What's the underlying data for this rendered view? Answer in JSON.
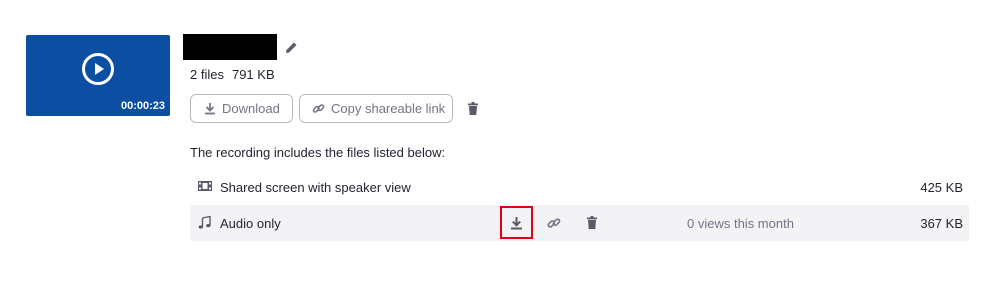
{
  "recording": {
    "duration": "00:00:23",
    "file_count": "2 files",
    "total_size": "791 KB"
  },
  "actions": {
    "download_label": "Download",
    "copy_link_label": "Copy shareable link"
  },
  "files_heading": "The recording includes the files listed below:",
  "files": [
    {
      "name": "Shared screen with speaker view",
      "size": "425 KB",
      "icon": "film-icon"
    },
    {
      "name": "Audio only",
      "size": "367 KB",
      "views": "0 views this month",
      "icon": "music-note-icon"
    }
  ],
  "colors": {
    "thumbnail": "#0b4ea2",
    "highlight": "#e0001b",
    "row_hover": "#f3f3f5"
  }
}
